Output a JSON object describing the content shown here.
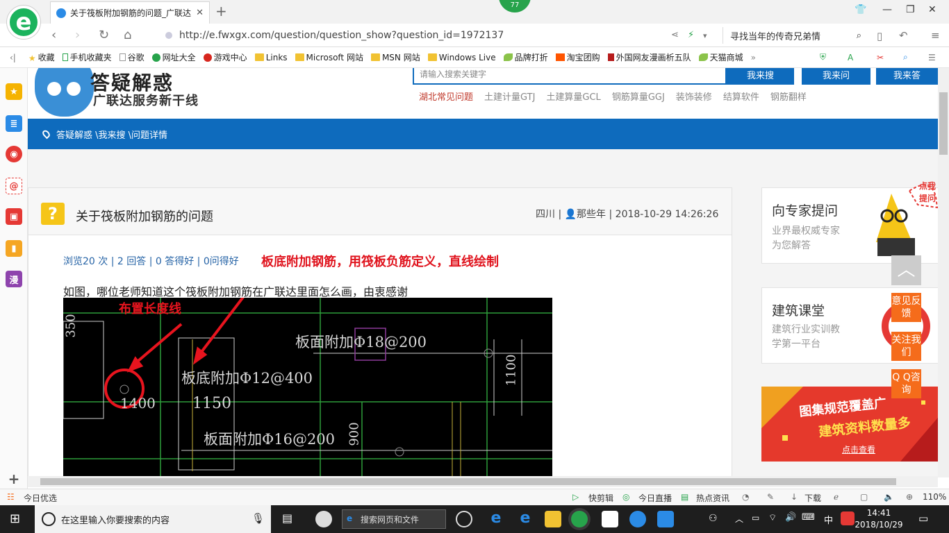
{
  "browser": {
    "tab_title": "关于筏板附加钢筋的问题_广联达",
    "tab_close": "✕",
    "new_tab": "+",
    "badge_count": "77",
    "url": "http://e.fwxgx.com/question/question_show?question_id=1972137",
    "search_text": "寻找当年的传奇兄弟情"
  },
  "favorites": [
    {
      "label": "收藏",
      "icon": "star-icon"
    },
    {
      "label": "手机收藏夹",
      "icon": "phone-icon"
    },
    {
      "label": "谷歌",
      "icon": "page-icon"
    },
    {
      "label": "网址大全",
      "icon": "globe-icon"
    },
    {
      "label": "游戏中心",
      "icon": "game-icon"
    },
    {
      "label": "Links",
      "icon": "folder-icon"
    },
    {
      "label": "Microsoft 网站",
      "icon": "folder-icon"
    },
    {
      "label": "MSN 网站",
      "icon": "folder-icon"
    },
    {
      "label": "Windows Live",
      "icon": "folder-icon"
    },
    {
      "label": "品牌打折",
      "icon": "leaf-icon"
    },
    {
      "label": "淘宝团购",
      "icon": "taobao-icon"
    },
    {
      "label": "外国网友漫画析五队",
      "icon": "bookmark-icon"
    },
    {
      "label": "天猫商城",
      "icon": "leaf-icon"
    }
  ],
  "sidebar_icons": [
    "favorites-star-icon",
    "news-icon",
    "weibo-icon",
    "mail-icon",
    "game-icon",
    "reader-icon",
    "comic-icon",
    "add-icon"
  ],
  "sidebar_comic_label": "漫",
  "site": {
    "title": "答疑解惑",
    "subtitle": "广联达服务新干线",
    "search_placeholder": "请输入搜索关键字",
    "btn_search": "我来搜",
    "btn_ask": "我来问",
    "btn_answer": "我来答",
    "hot_links": [
      "湖北常见问题",
      "土建计量GTJ",
      "土建算量GCL",
      "钢筋算量GGJ",
      "装饰装修",
      "结算软件",
      "钢筋翻样"
    ],
    "breadcrumb": "答疑解惑 \\我来搜 \\问题详情"
  },
  "question": {
    "icon": "?",
    "title": "关于筏板附加钢筋的问题",
    "meta": "四川 | 👤那些年 | 2018-10-29 14:26:26",
    "stats": "浏览20 次 | 2 回答 | 0 答得好 | 0问得好",
    "red_note": "板底附加钢筋，用筏板负筋定义，直线绘制",
    "text": "如图，哪位老师知道这个筏板附加钢筋在广联达里面怎么画，由衷感谢"
  },
  "cad": {
    "label_length": "布置长度线",
    "texts": [
      "板面附加Φ18@200",
      "板底附加Φ12@400",
      "1150",
      "板面附加Φ16@200",
      "1100",
      "900",
      "1400",
      "350"
    ]
  },
  "right": {
    "expert_title": "向专家提问",
    "expert_sub1": "业界最权威专家",
    "expert_sub2": "为您解答",
    "click_tip": "点我提问",
    "course_title": "建筑课堂",
    "course_sub1": "建筑行业实训教",
    "course_sub2": "学第一平台",
    "banner1": "图集规范覆盖广",
    "banner2": "建筑资料数量多",
    "banner3": "点击查看",
    "feedback": "意见反馈",
    "follow": "关注我们",
    "qq": "Q Q咨询"
  },
  "status": {
    "left": "今日优选",
    "items": [
      "快剪辑",
      "今日直播",
      "热点资讯",
      "下载"
    ],
    "zoom": "110%"
  },
  "taskbar": {
    "search_placeholder": "在这里输入你要搜索的内容",
    "addr_placeholder": "搜索网页和文件",
    "ime": "中",
    "time": "14:41",
    "date": "2018/10/29"
  }
}
